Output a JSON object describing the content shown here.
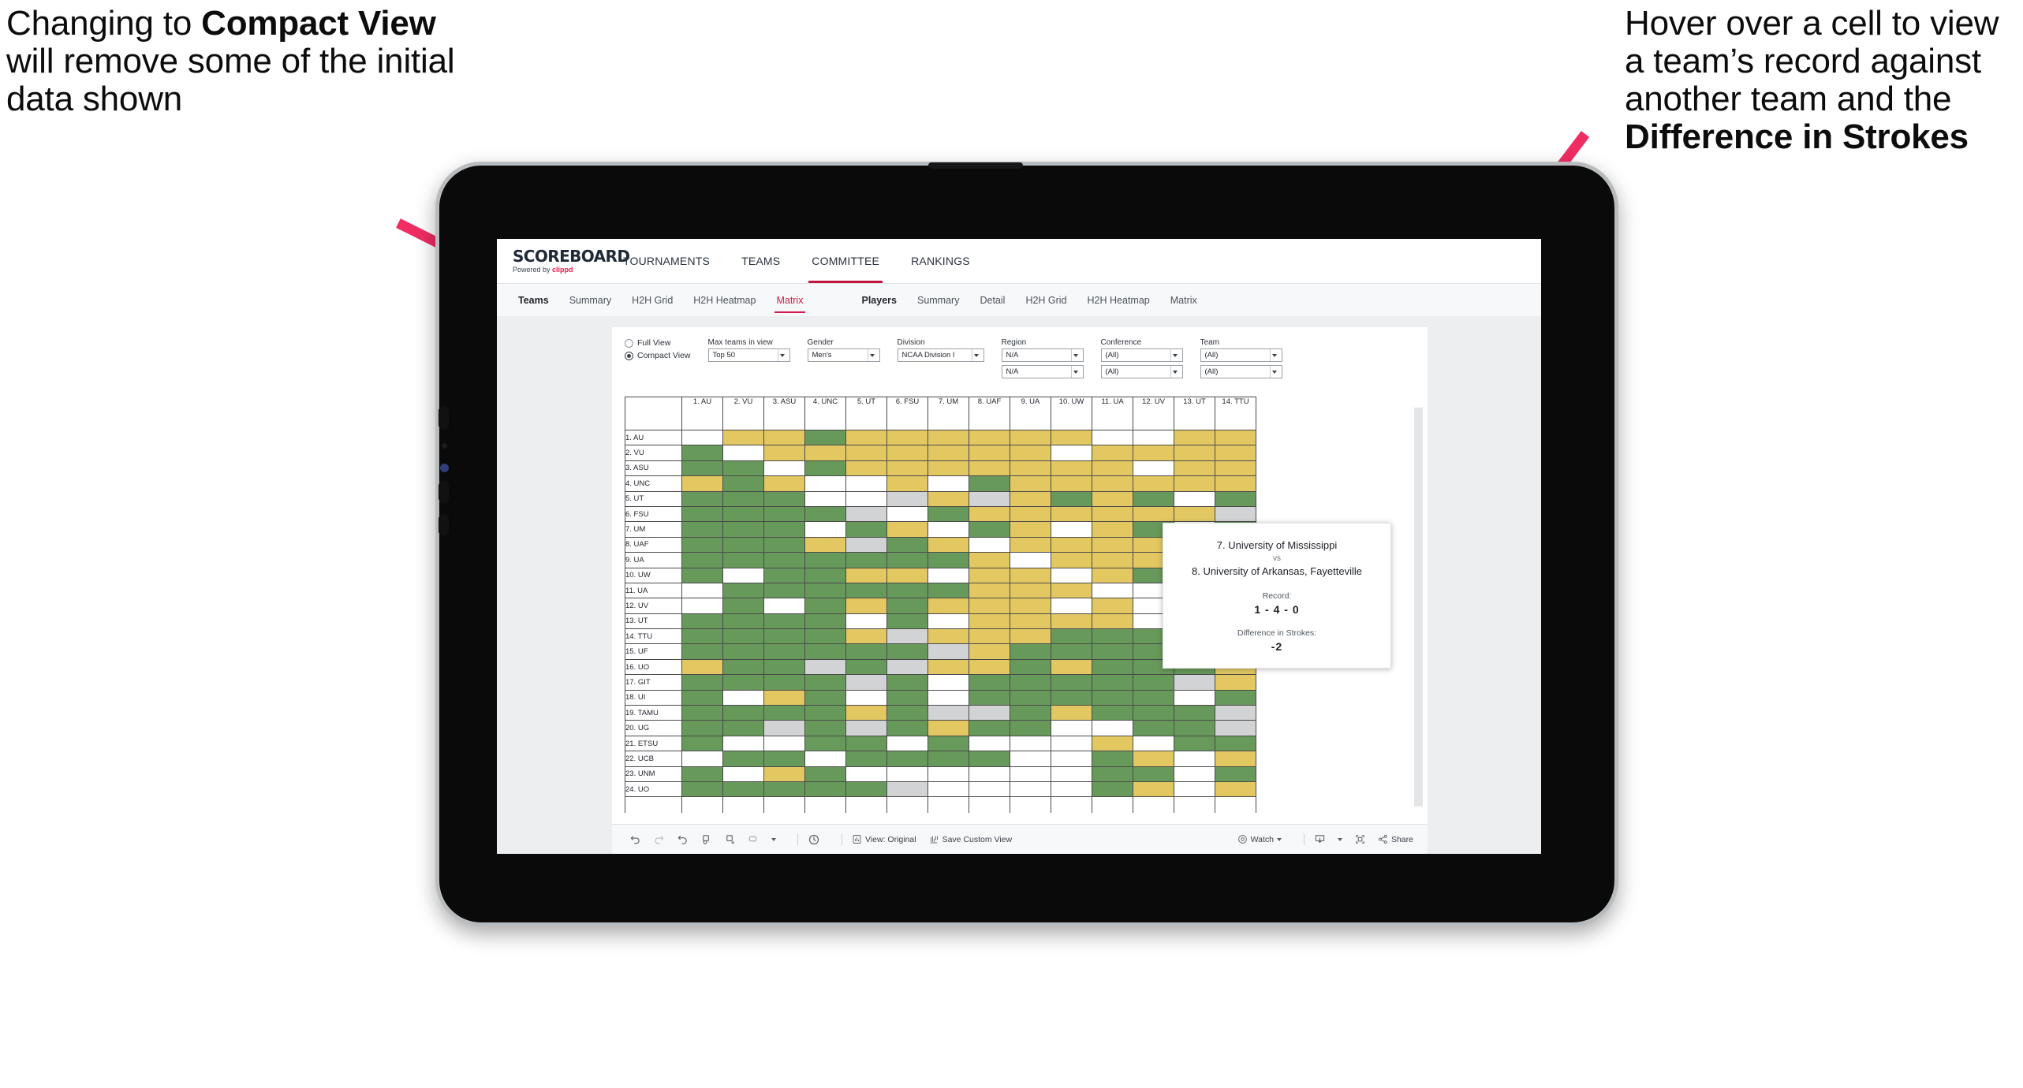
{
  "annotations": {
    "left": {
      "pre": "Changing to ",
      "bold": "Compact View",
      "post": " will remove some of the initial data shown"
    },
    "right": {
      "pre": "Hover over a cell to view a team’s record against another team and the ",
      "bold": "Difference in Strokes",
      "post": ""
    },
    "arrow_color": "#ef2d63"
  },
  "app": {
    "logo": {
      "main": "SCOREBOARD",
      "powered_prefix": "Powered by ",
      "powered_brand": "clippd"
    },
    "topnav": [
      {
        "label": "TOURNAMENTS",
        "active": false
      },
      {
        "label": "TEAMS",
        "active": false
      },
      {
        "label": "COMMITTEE",
        "active": true
      },
      {
        "label": "RANKINGS",
        "active": false
      }
    ],
    "subnav_teams": {
      "head": "Teams",
      "items": [
        {
          "label": "Summary",
          "active": false
        },
        {
          "label": "H2H Grid",
          "active": false
        },
        {
          "label": "H2H Heatmap",
          "active": false
        },
        {
          "label": "Matrix",
          "active": true
        }
      ]
    },
    "subnav_players": {
      "head": "Players",
      "items": [
        {
          "label": "Summary",
          "active": false
        },
        {
          "label": "Detail",
          "active": false
        },
        {
          "label": "H2H Grid",
          "active": false
        },
        {
          "label": "H2H Heatmap",
          "active": false
        },
        {
          "label": "Matrix",
          "active": false
        }
      ]
    },
    "filters": {
      "view_mode": {
        "full_label": "Full View",
        "compact_label": "Compact View",
        "selected": "Compact View"
      },
      "max_teams": {
        "label": "Max teams in view",
        "value": "Top 50"
      },
      "gender": {
        "label": "Gender",
        "value": "Men's"
      },
      "division": {
        "label": "Division",
        "value": "NCAA Division I"
      },
      "region": {
        "label": "Region",
        "value1": "N/A",
        "value2": "N/A"
      },
      "conference": {
        "label": "Conference",
        "value1": "(All)",
        "value2": "(All)"
      },
      "team": {
        "label": "Team",
        "value1": "(All)",
        "value2": "(All)"
      }
    },
    "tooltip": {
      "team_a": "7. University of Mississippi",
      "vs": "vs",
      "team_b": "8. University of Arkansas, Fayetteville",
      "record_label": "Record:",
      "record_value": "1 - 4 - 0",
      "diff_label": "Difference in Strokes:",
      "diff_value": "-2"
    },
    "toolbar": {
      "view_original": "View: Original",
      "save_custom_view": "Save Custom View",
      "watch": "Watch",
      "share": "Share"
    }
  },
  "chart_data": {
    "type": "heatmap",
    "title": "Teams Matrix",
    "legend": {
      "green": "#67995a",
      "yellow": "#e3c862",
      "gray": "#d2d3d4",
      "white": "#ffffff"
    },
    "columns": [
      "1. AU",
      "2. VU",
      "3. ASU",
      "4. UNC",
      "5. UT",
      "6. FSU",
      "7. UM",
      "8. UAF",
      "9. UA",
      "10. UW",
      "11. UA",
      "12. UV",
      "13. UT",
      "14. TTU"
    ],
    "rows": [
      "1. AU",
      "2. VU",
      "3. ASU",
      "4. UNC",
      "5. UT",
      "6. FSU",
      "7. UM",
      "8. UAF",
      "9. UA",
      "10. UW",
      "11. UA",
      "12. UV",
      "13. UT",
      "14. TTU",
      "15. UF",
      "16. UO",
      "17. GIT",
      "18. UI",
      "19. TAMU",
      "20. UG",
      "21. ETSU",
      "22. UCB",
      "23. UNM",
      "24. UO"
    ],
    "cells": [
      [
        "w",
        "y",
        "y",
        "g",
        "y",
        "y",
        "y",
        "y",
        "y",
        "y",
        "w",
        "w",
        "y",
        "y"
      ],
      [
        "g",
        "w",
        "y",
        "y",
        "y",
        "y",
        "y",
        "y",
        "y",
        "w",
        "y",
        "y",
        "y",
        "y"
      ],
      [
        "g",
        "g",
        "w",
        "g",
        "y",
        "y",
        "y",
        "y",
        "y",
        "y",
        "y",
        "w",
        "y",
        "y"
      ],
      [
        "y",
        "g",
        "y",
        "w",
        "w",
        "y",
        "w",
        "g",
        "y",
        "y",
        "y",
        "y",
        "y",
        "y"
      ],
      [
        "g",
        "g",
        "g",
        "w",
        "w",
        "a",
        "y",
        "a",
        "y",
        "g",
        "y",
        "g",
        "w",
        "g"
      ],
      [
        "g",
        "g",
        "g",
        "g",
        "a",
        "w",
        "g",
        "y",
        "y",
        "y",
        "y",
        "y",
        "y",
        "a"
      ],
      [
        "g",
        "g",
        "g",
        "w",
        "g",
        "y",
        "w",
        "g",
        "y",
        "w",
        "y",
        "g",
        "w",
        "g"
      ],
      [
        "g",
        "g",
        "g",
        "y",
        "a",
        "g",
        "y",
        "w",
        "y",
        "y",
        "y",
        "y",
        "y",
        "y"
      ],
      [
        "g",
        "g",
        "g",
        "g",
        "g",
        "g",
        "g",
        "y",
        "w",
        "y",
        "y",
        "y",
        "g",
        "y"
      ],
      [
        "g",
        "w",
        "g",
        "g",
        "y",
        "y",
        "w",
        "y",
        "y",
        "w",
        "y",
        "g",
        "y",
        "a"
      ],
      [
        "w",
        "g",
        "g",
        "g",
        "g",
        "g",
        "g",
        "y",
        "y",
        "y",
        "w",
        "w",
        "y",
        "y"
      ],
      [
        "w",
        "g",
        "w",
        "g",
        "y",
        "g",
        "y",
        "y",
        "y",
        "w",
        "y",
        "w",
        "w",
        "w"
      ],
      [
        "g",
        "g",
        "g",
        "g",
        "w",
        "g",
        "w",
        "y",
        "y",
        "y",
        "y",
        "w",
        "w",
        "y"
      ],
      [
        "g",
        "g",
        "g",
        "g",
        "y",
        "a",
        "y",
        "y",
        "y",
        "g",
        "g",
        "g",
        "w",
        "g"
      ],
      [
        "g",
        "g",
        "g",
        "g",
        "g",
        "g",
        "a",
        "y",
        "g",
        "g",
        "g",
        "g",
        "w",
        "g"
      ],
      [
        "y",
        "g",
        "g",
        "a",
        "g",
        "a",
        "y",
        "y",
        "g",
        "y",
        "g",
        "g",
        "g",
        "y"
      ],
      [
        "g",
        "g",
        "g",
        "g",
        "a",
        "g",
        "w",
        "g",
        "g",
        "g",
        "g",
        "g",
        "a",
        "y"
      ],
      [
        "g",
        "w",
        "y",
        "g",
        "w",
        "g",
        "w",
        "g",
        "g",
        "g",
        "g",
        "g",
        "w",
        "g"
      ],
      [
        "g",
        "g",
        "g",
        "g",
        "y",
        "g",
        "a",
        "a",
        "g",
        "y",
        "g",
        "g",
        "g",
        "a"
      ],
      [
        "g",
        "g",
        "a",
        "g",
        "a",
        "g",
        "y",
        "g",
        "g",
        "w",
        "w",
        "g",
        "g",
        "a"
      ],
      [
        "g",
        "w",
        "w",
        "g",
        "g",
        "w",
        "g",
        "w",
        "w",
        "w",
        "y",
        "w",
        "g",
        "g"
      ],
      [
        "w",
        "g",
        "g",
        "w",
        "g",
        "g",
        "g",
        "g",
        "w",
        "w",
        "g",
        "y",
        "w",
        "y"
      ],
      [
        "g",
        "w",
        "y",
        "g",
        "w",
        "w",
        "w",
        "w",
        "w",
        "w",
        "g",
        "g",
        "w",
        "g"
      ],
      [
        "g",
        "g",
        "g",
        "g",
        "g",
        "a",
        "w",
        "w",
        "w",
        "w",
        "g",
        "y",
        "w",
        "y"
      ]
    ]
  }
}
